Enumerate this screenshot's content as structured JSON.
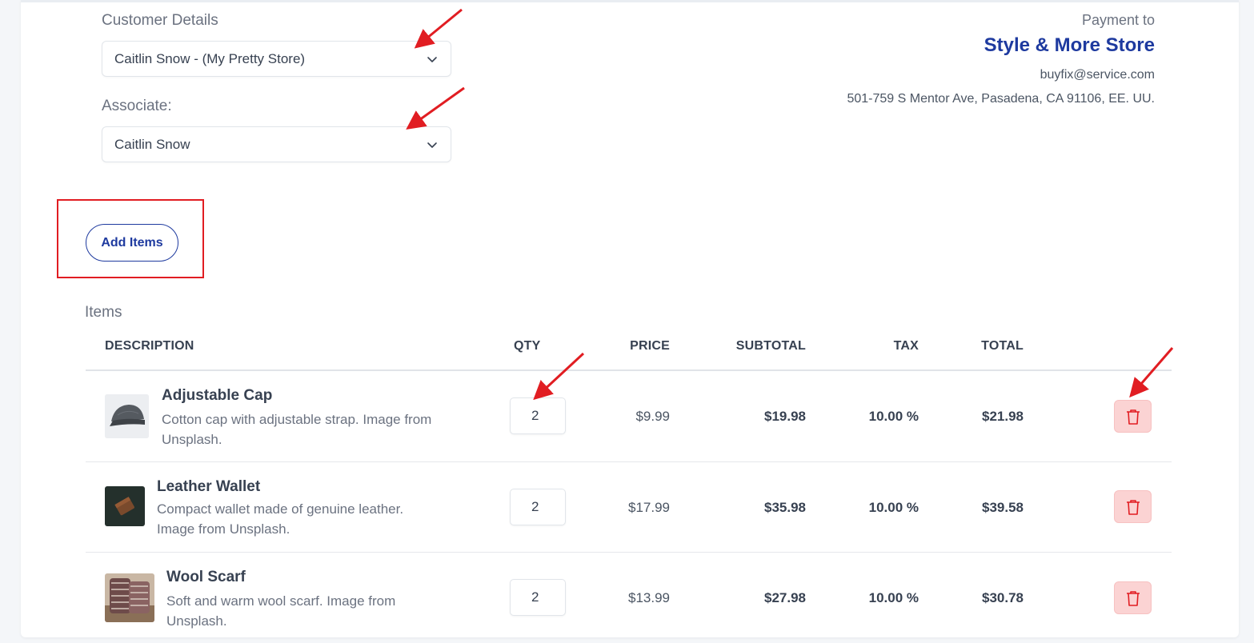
{
  "customer": {
    "label": "Customer Details",
    "selected": "Caitlin Snow - (My Pretty Store)"
  },
  "associate": {
    "label": "Associate:",
    "selected": "Caitlin Snow"
  },
  "payment": {
    "label": "Payment to",
    "store_name": "Style & More Store",
    "email": "buyfix@service.com",
    "address": "501-759 S Mentor Ave, Pasadena, CA 91106, EE. UU."
  },
  "actions": {
    "add_items": "Add Items"
  },
  "items": {
    "title": "Items",
    "columns": [
      "DESCRIPTION",
      "QTY",
      "PRICE",
      "SUBTOTAL",
      "TAX",
      "TOTAL"
    ],
    "rows": [
      {
        "name": "Adjustable Cap",
        "description": "Cotton cap with adjustable strap. Image from Unsplash.",
        "qty": "2",
        "price": "$9.99",
        "subtotal": "$19.98",
        "tax": "10.00 %",
        "total": "$21.98",
        "thumb_icon": "cap-thumbnail"
      },
      {
        "name": "Leather Wallet",
        "description": "Compact wallet made of genuine leather. Image from Unsplash.",
        "qty": "2",
        "price": "$17.99",
        "subtotal": "$35.98",
        "tax": "10.00 %",
        "total": "$39.58",
        "thumb_icon": "wallet-thumbnail"
      },
      {
        "name": "Wool Scarf",
        "description": "Soft and warm wool scarf. Image from Unsplash.",
        "qty": "2",
        "price": "$13.99",
        "subtotal": "$27.98",
        "tax": "10.00 %",
        "total": "$30.78",
        "thumb_icon": "scarf-thumbnail"
      }
    ]
  },
  "colors": {
    "brand": "#1e3a9f",
    "annotation_red": "#e11d22",
    "delete_bg": "#fbd3d3",
    "delete_icon": "#e11d22"
  }
}
